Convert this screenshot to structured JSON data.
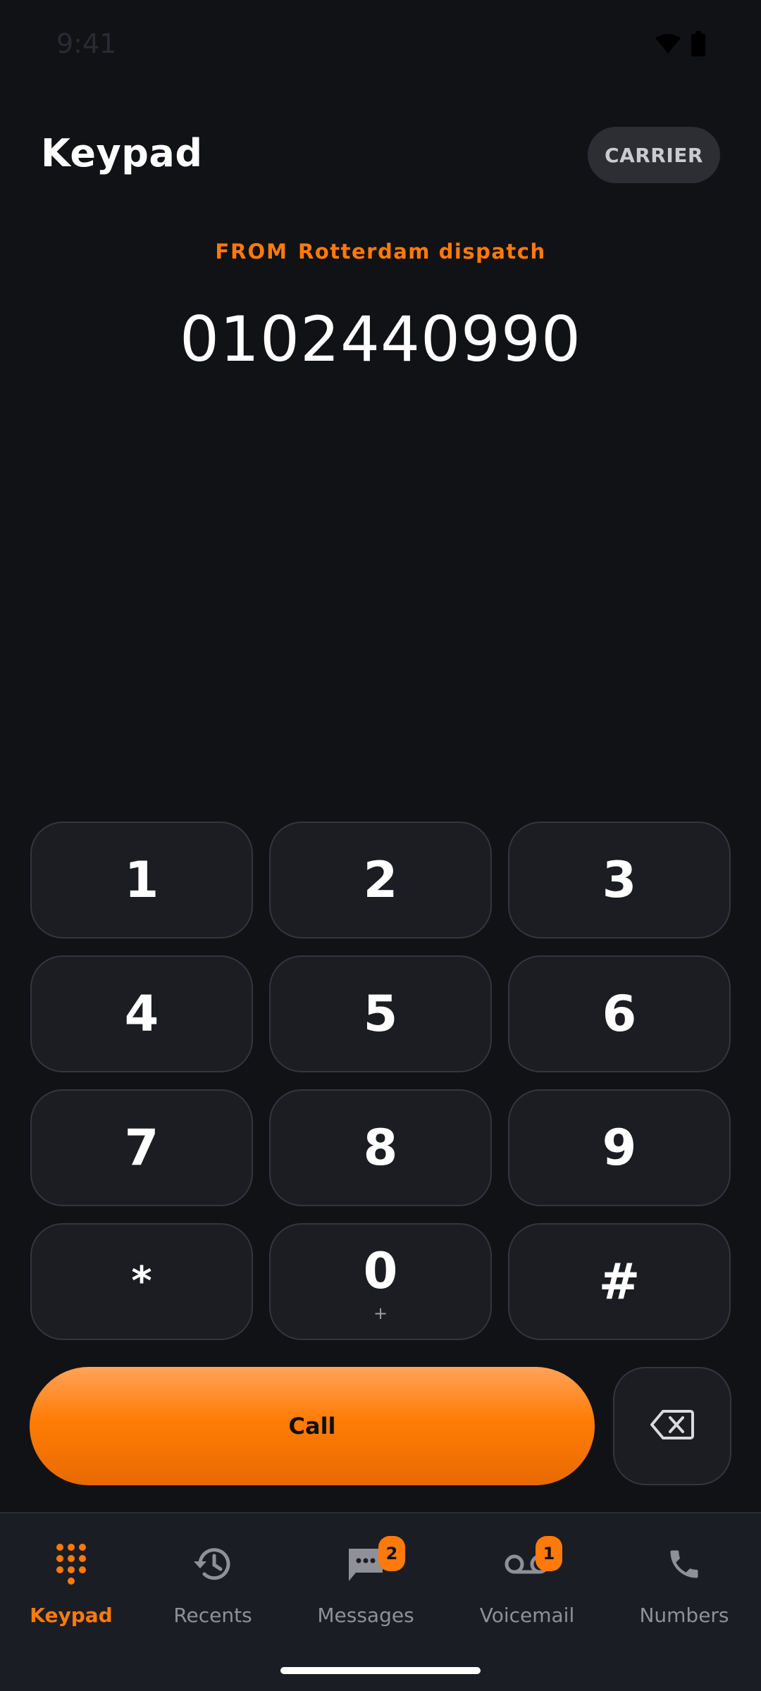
{
  "status_bar": {
    "time": "9:41",
    "icons": [
      "wifi-icon",
      "battery-icon"
    ]
  },
  "header": {
    "title": "Keypad",
    "carrier_label": "CARRIER"
  },
  "caller_id": {
    "prefix": "FROM",
    "name": "Rotterdam dispatch"
  },
  "dialed_number": "0102440990",
  "keypad": {
    "keys": [
      {
        "digit": "1",
        "sub": ""
      },
      {
        "digit": "2",
        "sub": ""
      },
      {
        "digit": "3",
        "sub": ""
      },
      {
        "digit": "4",
        "sub": ""
      },
      {
        "digit": "5",
        "sub": ""
      },
      {
        "digit": "6",
        "sub": ""
      },
      {
        "digit": "7",
        "sub": ""
      },
      {
        "digit": "8",
        "sub": ""
      },
      {
        "digit": "9",
        "sub": ""
      },
      {
        "digit": "*",
        "sub": ""
      },
      {
        "digit": "0",
        "sub": "+"
      },
      {
        "digit": "#",
        "sub": ""
      }
    ]
  },
  "call_button": {
    "label": "Call",
    "color": "#ff7c06"
  },
  "backspace_icon": "backspace-icon",
  "bottom_nav": {
    "items": [
      {
        "label": "Keypad",
        "icon": "keypad-dots-icon",
        "badge": "",
        "active": true
      },
      {
        "label": "Recents",
        "icon": "history-icon",
        "badge": "",
        "active": false
      },
      {
        "label": "Messages",
        "icon": "message-bubble-icon",
        "badge": "2",
        "active": false
      },
      {
        "label": "Voicemail",
        "icon": "voicemail-icon",
        "badge": "1",
        "active": false
      },
      {
        "label": "Numbers",
        "icon": "phone-icon",
        "badge": "",
        "active": false
      }
    ]
  },
  "colors": {
    "accent": "#ff7a0a",
    "background": "#111215",
    "key_background": "#1b1d22",
    "nav_background": "#1b1d25"
  }
}
